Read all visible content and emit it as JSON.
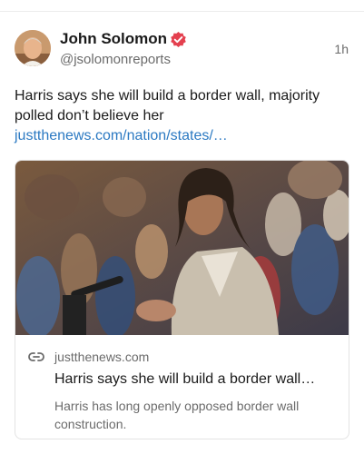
{
  "post": {
    "author": {
      "name": "John Solomon",
      "handle": "@jsolomonreports",
      "verified_icon": "verified-badge-icon",
      "verified_color": "#e4404f"
    },
    "timestamp": "1h",
    "text": "Harris says she will build a border wall, majority polled don’t believe her",
    "link_text": "justthenews.com/nation/states/…",
    "link_color": "#2b79c2",
    "card": {
      "domain": "justthenews.com",
      "title": "Harris says she will build a border wall…",
      "description": "Harris has long openly opposed border wall construction.",
      "link_icon": "link-icon"
    }
  }
}
